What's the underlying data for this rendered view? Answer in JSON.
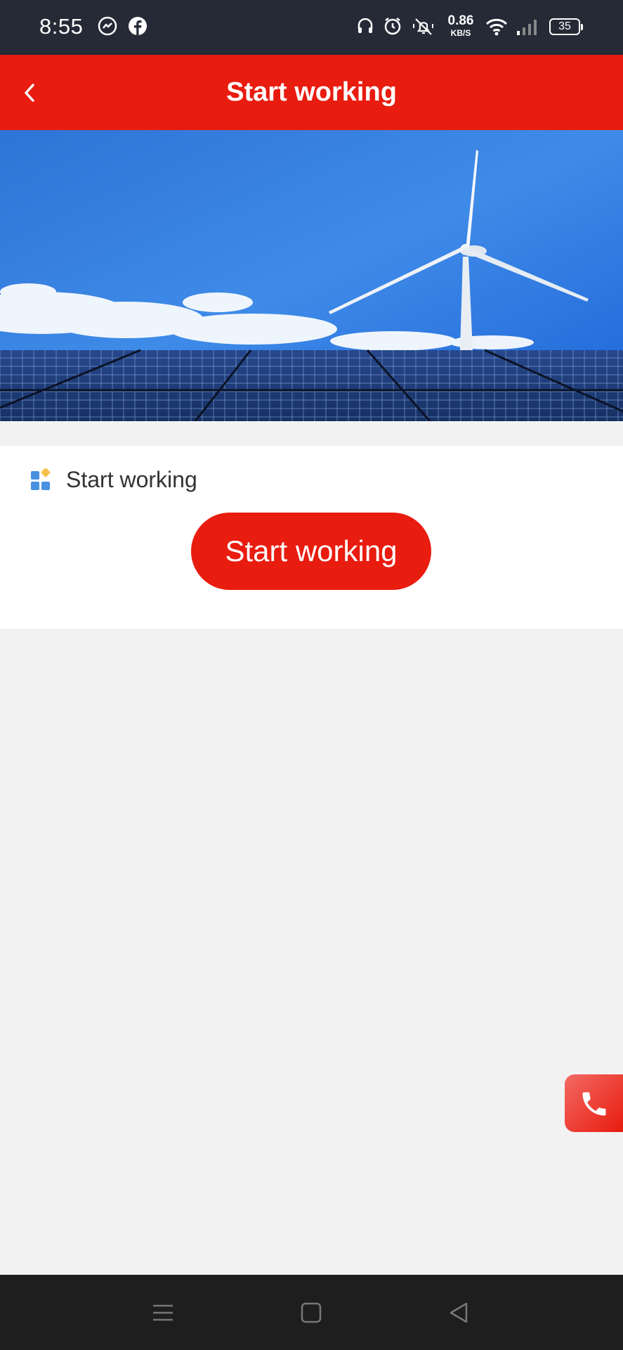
{
  "status_bar": {
    "time": "8:55",
    "net_speed_value": "0.86",
    "net_speed_unit": "KB/S",
    "battery": "35",
    "icons": [
      "messenger-icon",
      "facebook-icon",
      "headset-icon",
      "alarm-icon",
      "mute-icon",
      "wifi-icon",
      "signal-icon",
      "battery-icon"
    ]
  },
  "header": {
    "title": "Start working",
    "back_icon": "chevron-left-icon"
  },
  "banner": {
    "image": "solar-panels-wind-turbine"
  },
  "card": {
    "section_title": "Start working",
    "section_icon": "apps-grid-icon",
    "button_label": "Start working"
  },
  "floating": {
    "call_icon": "phone-icon"
  },
  "nav_bar": {
    "items": [
      "menu-icon",
      "home-icon",
      "back-icon"
    ]
  },
  "colors": {
    "accent": "#e81c0f",
    "status_bar": "#252a36",
    "background": "#f2f2f2",
    "nav_bar": "#1e1e1e"
  }
}
